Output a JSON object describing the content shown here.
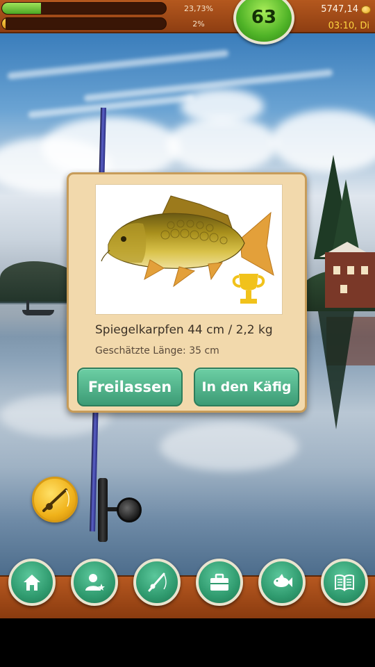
{
  "hud": {
    "xp_percent_label": "23,73%",
    "xp_progress": 0.2373,
    "second_percent_label": "2%",
    "second_progress": 0.02,
    "level": "63",
    "money": "5747,14",
    "time": "03:10, Di"
  },
  "catch_dialog": {
    "fish_name": "Spiegelkarpfen 44 cm / 2,2 kg",
    "estimated_length": "Geschätzte Länge: 35 cm",
    "release_label": "Freilassen",
    "keep_label": "In den Käfig",
    "fish_image": "mirror-carp",
    "trophy_icon": "trophy-icon"
  },
  "side": {
    "rod_icon": "fishing-rod-icon"
  },
  "nav": {
    "items": [
      {
        "icon": "home-icon"
      },
      {
        "icon": "profile-star-icon"
      },
      {
        "icon": "fishing-rod-icon"
      },
      {
        "icon": "briefcase-icon"
      },
      {
        "icon": "fish-icon"
      },
      {
        "icon": "book-icon"
      }
    ]
  },
  "colors": {
    "hud_brown": "#a24a17",
    "button_green": "#3c9b75",
    "level_green": "#4fb327",
    "gold": "#f0b21a"
  }
}
